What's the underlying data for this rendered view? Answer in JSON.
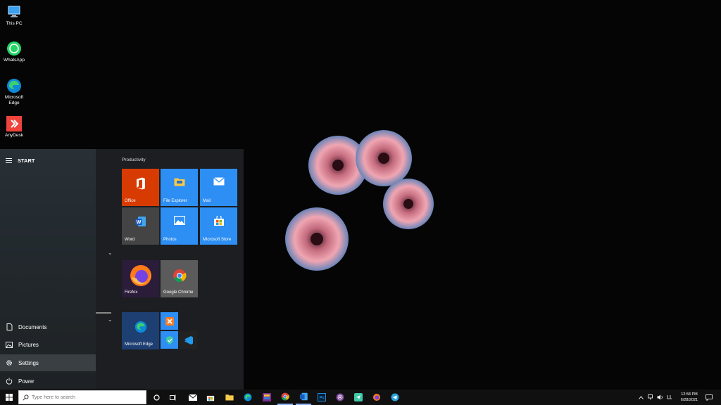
{
  "desktop": {
    "icons": [
      {
        "label": "This PC",
        "icon": "pc-icon"
      },
      {
        "label": "WhatsApp",
        "icon": "whatsapp-icon"
      },
      {
        "label": "Microsoft Edge",
        "icon": "edge-icon"
      },
      {
        "label": "AnyDesk",
        "icon": "anydesk-icon"
      }
    ]
  },
  "start_menu": {
    "header": "START",
    "left_items": [
      {
        "label": "Documents",
        "icon": "document-icon"
      },
      {
        "label": "Pictures",
        "icon": "pictures-icon"
      },
      {
        "label": "Settings",
        "icon": "gear-icon"
      },
      {
        "label": "Power",
        "icon": "power-icon"
      }
    ],
    "group_label": "Productivity",
    "tiles": {
      "office": "Office",
      "file_explorer": "File Explorer",
      "mail": "Mail",
      "word": "Word",
      "photos": "Photos",
      "microsoft_store": "Microsoft Store",
      "firefox": "Firefox",
      "google_chrome": "Google Chrome",
      "microsoft_edge": "Microsoft Edge"
    },
    "colors": {
      "office": "#d83b01",
      "blue_tile": "#2d8ef3",
      "word": "#444444",
      "firefox": "#2b1c3a",
      "chrome": "#5b5b5b",
      "edge": "#1e3f72"
    }
  },
  "taskbar": {
    "search_placeholder": "Type here to search",
    "time": "12:58 PM",
    "date": "6/28/2021"
  }
}
